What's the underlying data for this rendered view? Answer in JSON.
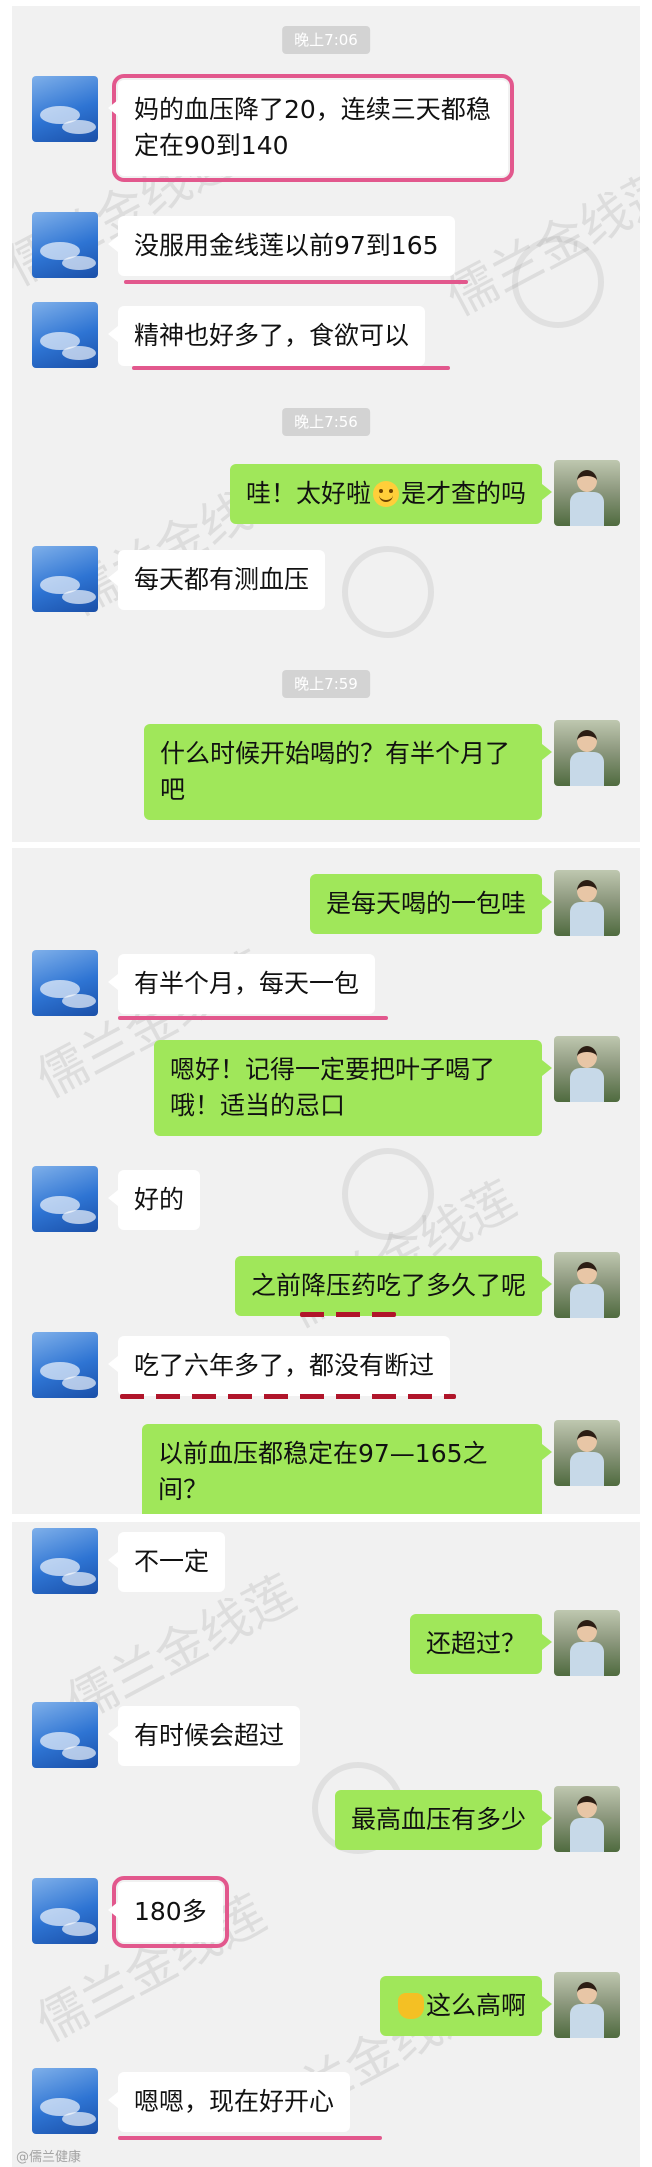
{
  "panel1": {
    "time_1": "晚上7:06",
    "msg_1": "妈的血压降了20，连续三天都稳定在90到140",
    "msg_2": "没服用金线莲以前97到165",
    "msg_3": "精神也好多了，食欲可以",
    "time_2": "晚上7:56",
    "msg_4_pre": "哇！太好啦",
    "msg_4_emoji": "smile-emoji",
    "msg_4_post": "是才查的吗",
    "msg_5": "每天都有测血压",
    "time_3": "晚上7:59",
    "msg_6": "什么时候开始喝的？有半个月了吧"
  },
  "panel2": {
    "msg_1": "是每天喝的一包哇",
    "msg_2": "有半个月，每天一包",
    "msg_3": "嗯好！记得一定要把叶子喝了哦！适当的忌口",
    "msg_4": "好的",
    "msg_5": "之前降压药吃了多久了呢",
    "msg_6": "吃了六年多了，都没有断过",
    "msg_7": "以前血压都稳定在97—165之间？"
  },
  "panel3": {
    "msg_1": "不一定",
    "msg_2": "还超过？",
    "msg_3": "有时候会超过",
    "msg_4": "最高血压有多少",
    "msg_5": "180多",
    "msg_6_emoji": "clapping-hands-emoji",
    "msg_6": "这么高啊",
    "msg_7": "嗯嗯，现在好开心"
  },
  "watermark": {
    "text": "儒兰金线莲",
    "corner": "@儒兰健康"
  },
  "colors": {
    "chat_background": "#f1f1f1",
    "incoming_bubble": "#ffffff",
    "outgoing_bubble": "#a0e75a",
    "highlight": "#e2588d",
    "dash_underline": "#b0152a",
    "timestamp_bg": "#d3d3d3"
  },
  "avatars": {
    "incoming": "sky-avatar",
    "outgoing": "girl-photo-avatar"
  }
}
